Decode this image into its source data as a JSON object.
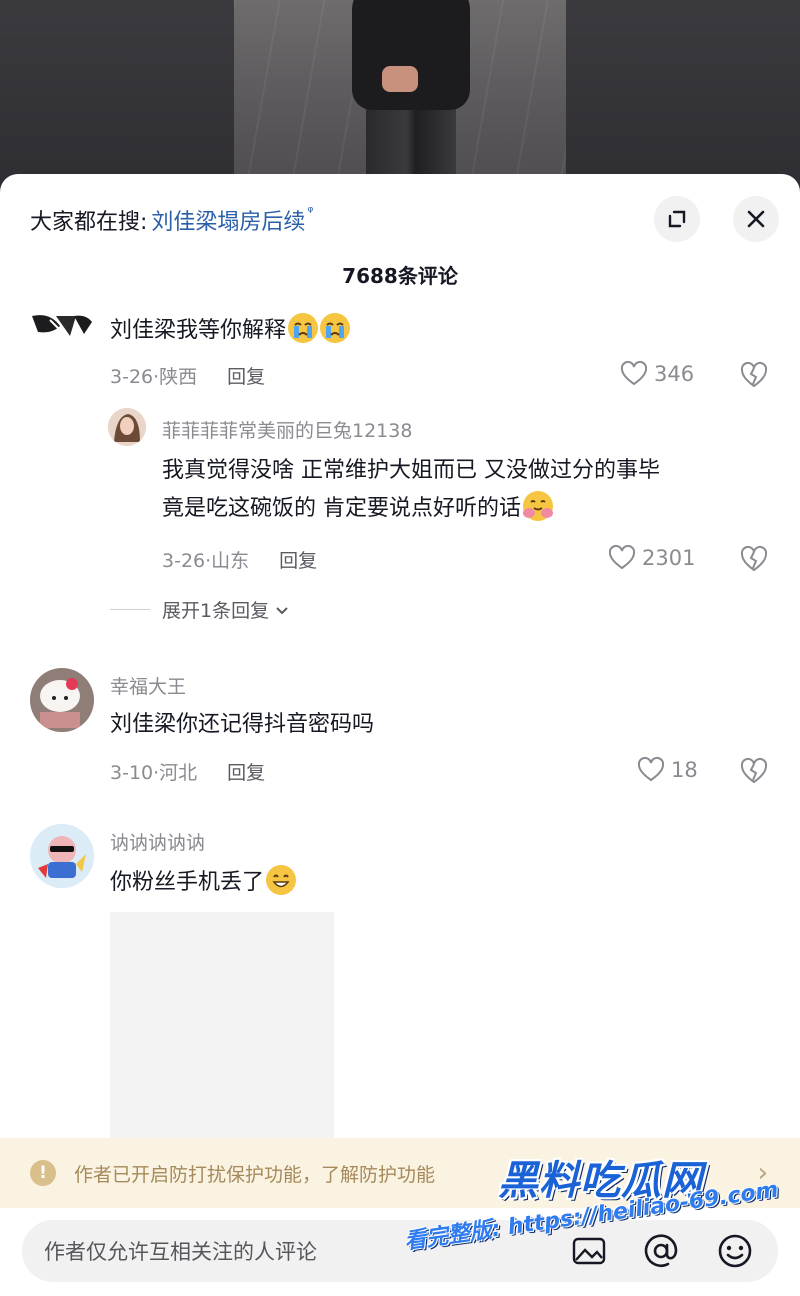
{
  "search": {
    "prefix": "大家都在搜:",
    "term": "刘佳梁塌房后续",
    "glyph": "ᵠ"
  },
  "header": {
    "comment_count": "7688条评论"
  },
  "comments": [
    {
      "username": "",
      "text": "刘佳梁我等你解释",
      "emoji": [
        "crying-face",
        "crying-face"
      ],
      "date_location": "3-26·陕西",
      "reply_label": "回复",
      "likes": "346",
      "replies": [
        {
          "username": "菲菲菲菲常美丽的巨兔12138",
          "text_line1": "我真觉得没啥 正常维护大姐而已 又没做过分的事毕",
          "text_line2": "竟是吃这碗饭的 肯定要说点好听的话",
          "emoji": "hugging-face",
          "date_location": "3-26·山东",
          "reply_label": "回复",
          "likes": "2301"
        }
      ],
      "expand_label": "展开1条回复"
    },
    {
      "username": "幸福大王",
      "text": "刘佳梁你还记得抖音密码吗",
      "date_location": "3-10·河北",
      "reply_label": "回复",
      "likes": "18"
    },
    {
      "username": "讷讷讷讷讷",
      "text": "你粉丝手机丢了",
      "emoji": "grinning-face"
    }
  ],
  "notice": {
    "text": "作者已开启防打扰保护功能，了解防护功能"
  },
  "input": {
    "placeholder": "作者仅允许互相关注的人评论"
  },
  "watermark": {
    "title": "黑料吃瓜网",
    "subtitle": "看完整版: https://heiliao-69.com"
  },
  "colors": {
    "link_blue": "#2b5fa8",
    "text_primary": "#161823",
    "text_secondary": "#8a8b91",
    "notice_bg": "#fbf3e2",
    "watermark_blue": "#1b62d6"
  }
}
